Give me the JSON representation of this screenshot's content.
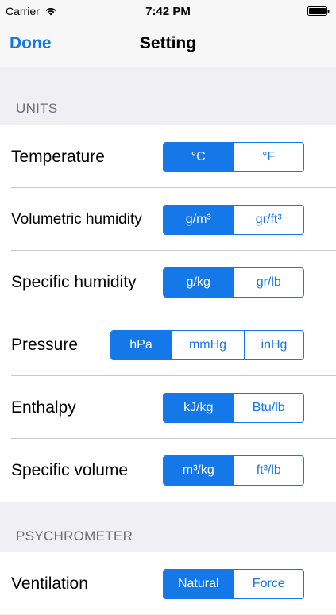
{
  "status": {
    "carrier": "Carrier",
    "time": "7:42 PM"
  },
  "nav": {
    "done_label": "Done",
    "title": "Setting"
  },
  "sections": {
    "units": "UNITS",
    "psychrometer": "PSYCHROMETER"
  },
  "rows": [
    {
      "label": "Temperature",
      "options": [
        "°C",
        "°F"
      ],
      "selected": 0
    },
    {
      "label": "Volumetric humidity",
      "options": [
        "g/m³",
        "gr/ft³"
      ],
      "selected": 0
    },
    {
      "label": "Specific humidity",
      "options": [
        "g/kg",
        "gr/lb"
      ],
      "selected": 0
    },
    {
      "label": "Pressure",
      "options": [
        "hPa",
        "mmHg",
        "inHg"
      ],
      "selected": 0
    },
    {
      "label": "Enthalpy",
      "options": [
        "kJ/kg",
        "Btu/lb"
      ],
      "selected": 0
    },
    {
      "label": "Specific volume",
      "options": [
        "m³/kg",
        "ft³/lb"
      ],
      "selected": 0
    }
  ],
  "psychrometer_rows": [
    {
      "label": "Ventilation",
      "options": [
        "Natural",
        "Force"
      ],
      "selected": 0
    }
  ],
  "colors": {
    "accent": "#1478e8",
    "background": "#efeff4"
  }
}
